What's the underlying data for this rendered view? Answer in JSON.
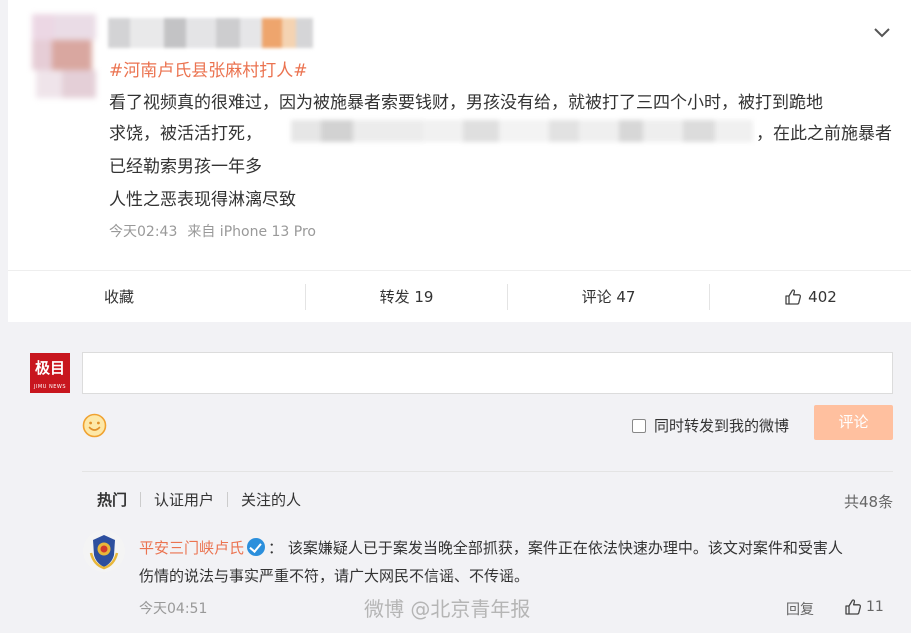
{
  "post": {
    "topic": "#河南卢氏县张麻村打人#",
    "line1": "看了视频真的很难过，因为被施暴者索要钱财，男孩没有给，就被打了三四个小时，被打到跪地",
    "line2a": "求饶，被活活打死，",
    "line2b": "，在此之前施暴者",
    "line3": "已经勒索男孩一年多",
    "line4": "人性之恶表现得淋漓尽致",
    "time": "今天02:43",
    "source": "来自 iPhone 13 Pro"
  },
  "actions": {
    "collect": "收藏",
    "repost": "转发 19",
    "comment": "评论 47",
    "like": "402"
  },
  "composer": {
    "logo_text": "极目",
    "logo_sub": "JIMU NEWS",
    "repost_option": "同时转发到我的微博",
    "submit": "评论"
  },
  "comment_tabs": {
    "hot": "热门",
    "verified": "认证用户",
    "following": "关注的人",
    "total": "共48条"
  },
  "comment": {
    "user": "平安三门峡卢氏",
    "sep": "：",
    "text1": "该案嫌疑人已于案发当晚全部抓获，案件正在依法快速办理中。该文对案件和受害人",
    "text2": "伤情的说法与事实严重不符，请广大网民不信谣、不传谣。",
    "time": "今天04:51",
    "reply": "回复",
    "likes": "11"
  },
  "watermark": "微博 @北京青年报",
  "colors": {
    "accent": "#eb7350",
    "button_disabled": "#ffc09f",
    "verified_blue": "#2b8fdc",
    "logo_red": "#c8161e"
  }
}
